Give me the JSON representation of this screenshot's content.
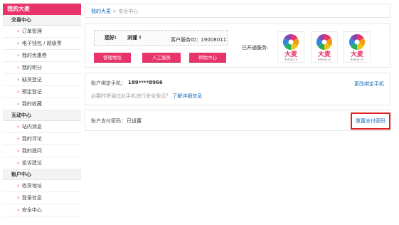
{
  "sidebar": {
    "title": "我的大麦",
    "sections": [
      {
        "label": "交易中心",
        "items": [
          "订单管理",
          "电子钱包 / 超级票",
          "我的优惠券",
          "我的积分",
          "缺货登记",
          "预定登记",
          "我的收藏"
        ]
      },
      {
        "label": "互动中心",
        "items": [
          "站内消息",
          "我的评论",
          "我的提问",
          "投诉建议"
        ]
      },
      {
        "label": "账户中心",
        "items": [
          "收货地址",
          "登录信息",
          "安全中心"
        ]
      }
    ]
  },
  "breadcrumb": {
    "home": "我的大麦",
    "separator": " > ",
    "current": "安全中心"
  },
  "user": {
    "greeting": "您好:",
    "name": "浏谨 !",
    "customer_id": "客户服务ID：19008011",
    "buttons": [
      "管理地址",
      "人工服务",
      "帮助中心"
    ],
    "opened_services_label": "已开通服务:",
    "service_logo_text": "大麦",
    "service_logo_sub": "damai.cn"
  },
  "binding": {
    "label": "账户绑定手机：",
    "phone": "189****8966",
    "change_link": "更改绑定手机",
    "note": "必要时将通过此手机进行安全验证？",
    "note_link": "了解详细信息"
  },
  "payment": {
    "label": "账户支付密码：",
    "status": "已设置",
    "reset_link": "重置支付密码"
  },
  "colors": {
    "accent": "#e8336b",
    "link": "#1a6bb8",
    "highlight": "#e02020"
  }
}
